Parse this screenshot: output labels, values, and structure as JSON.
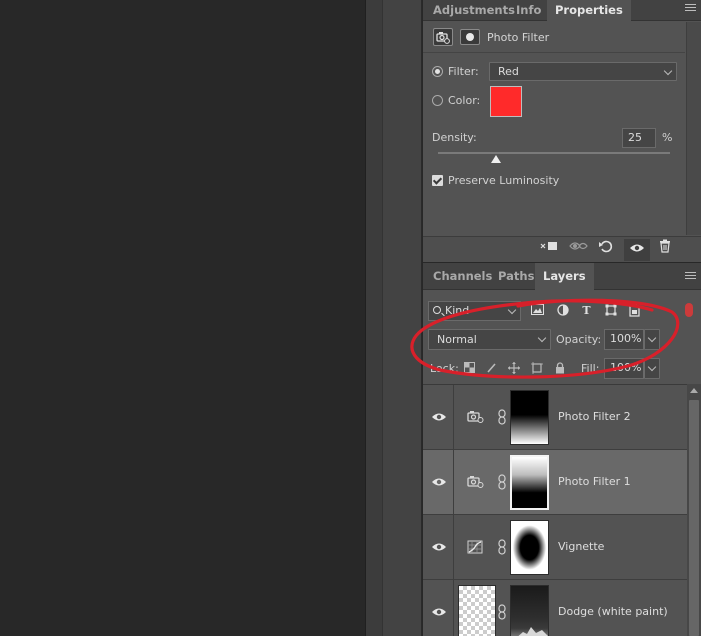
{
  "properties_panel": {
    "tabs": [
      {
        "label": "Adjustments",
        "active": false
      },
      {
        "label": "Info",
        "active": false
      },
      {
        "label": "Properties",
        "active": true
      }
    ],
    "header_title": "Photo Filter",
    "filter_label": "Filter:",
    "filter_value": "Red",
    "color_label": "Color:",
    "color_swatch": "#ff2a2a",
    "density_label": "Density:",
    "density_value": "25",
    "density_unit": "%",
    "density_fraction": 0.25,
    "preserve_luminosity_label": "Preserve Luminosity",
    "preserve_luminosity_checked": true
  },
  "layers_panel": {
    "tabs": [
      {
        "label": "Channels",
        "active": false
      },
      {
        "label": "Paths",
        "active": false
      },
      {
        "label": "Layers",
        "active": true
      }
    ],
    "kind_filter": "Kind",
    "blend_mode": "Normal",
    "opacity_label": "Opacity:",
    "opacity_value": "100%",
    "lock_label": "Lock:",
    "fill_label": "Fill:",
    "fill_value": "100%",
    "layers": [
      {
        "name": "Photo Filter 2",
        "selected": false
      },
      {
        "name": "Photo Filter 1",
        "selected": true
      },
      {
        "name": "Vignette",
        "selected": false
      },
      {
        "name": "Dodge (white paint)",
        "selected": false
      }
    ]
  },
  "colors": {
    "annotation": "#d8202a",
    "panel_bg": "#535353",
    "selected_row": "#696969"
  }
}
